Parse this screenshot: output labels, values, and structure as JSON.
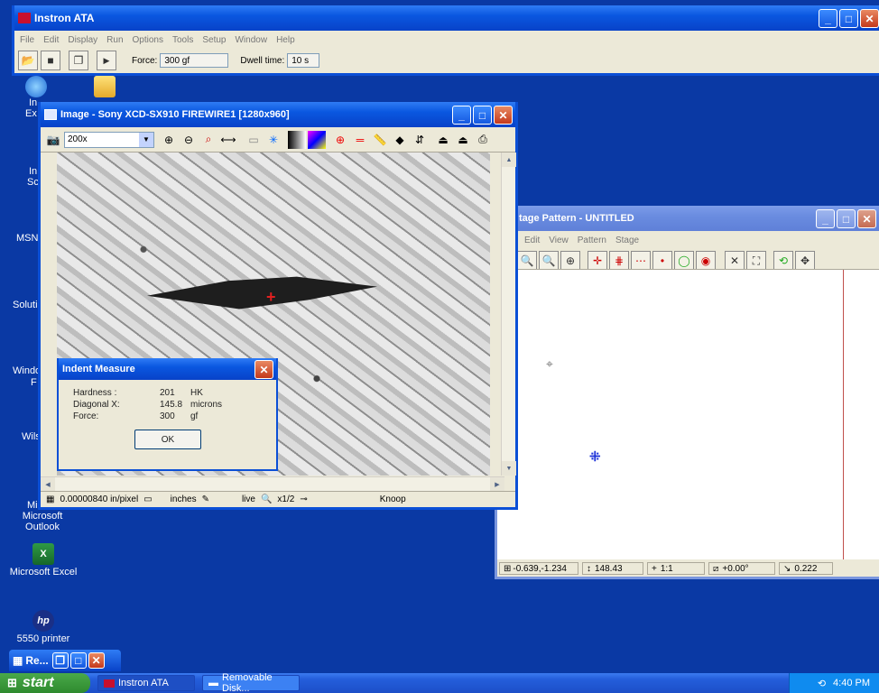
{
  "desktop": {
    "icons": [
      {
        "label": "Microsoft Outlook",
        "icon": "outlook-icon"
      },
      {
        "label": "Microsoft Excel",
        "icon": "excel-icon"
      },
      {
        "label": "5550 printer",
        "icon": "printer-icon"
      }
    ],
    "partial_labels": [
      "In",
      "Ex",
      "In",
      "Sc",
      "MSN",
      "Soluti",
      "Windo",
      "F",
      "Wils",
      "Mi"
    ]
  },
  "main_window": {
    "title": "Instron ATA",
    "menu": [
      "File",
      "Edit",
      "Display",
      "Run",
      "Options",
      "Tools",
      "Setup",
      "Window",
      "Help"
    ],
    "force_label": "Force:",
    "force_value": "300 gf",
    "dwell_label": "Dwell time:",
    "dwell_value": "10 s"
  },
  "image_window": {
    "title": "Image - Sony XCD-SX910 FIREWIRE1 [1280x960]",
    "zoom": "200x",
    "status": {
      "scale": "0.00000840 in/pixel",
      "units": "inches",
      "mode": "live",
      "zoom": "x1/2",
      "method": "Knoop"
    }
  },
  "indent_dialog": {
    "title": "Indent Measure",
    "rows": [
      {
        "label": "Hardness  :",
        "value": "201",
        "unit": "HK"
      },
      {
        "label": "Diagonal X:",
        "value": "145.8",
        "unit": "microns"
      },
      {
        "label": "Force:",
        "value": "300",
        "unit": "gf"
      }
    ],
    "ok_label": "OK"
  },
  "stage_window": {
    "title": "tage Pattern - UNTITLED",
    "menu": [
      "Edit",
      "View",
      "Pattern",
      "Stage"
    ],
    "status": {
      "coords": "-0.639,-1.234",
      "value": "148.43",
      "ratio": "1:1",
      "angle": "+0.00°",
      "dist": "0.222"
    }
  },
  "minimized_window": {
    "title": "Re..."
  },
  "taskbar": {
    "start": "start",
    "tasks": [
      "Instron ATA",
      "Removable Disk..."
    ],
    "clock": "4:40 PM"
  }
}
